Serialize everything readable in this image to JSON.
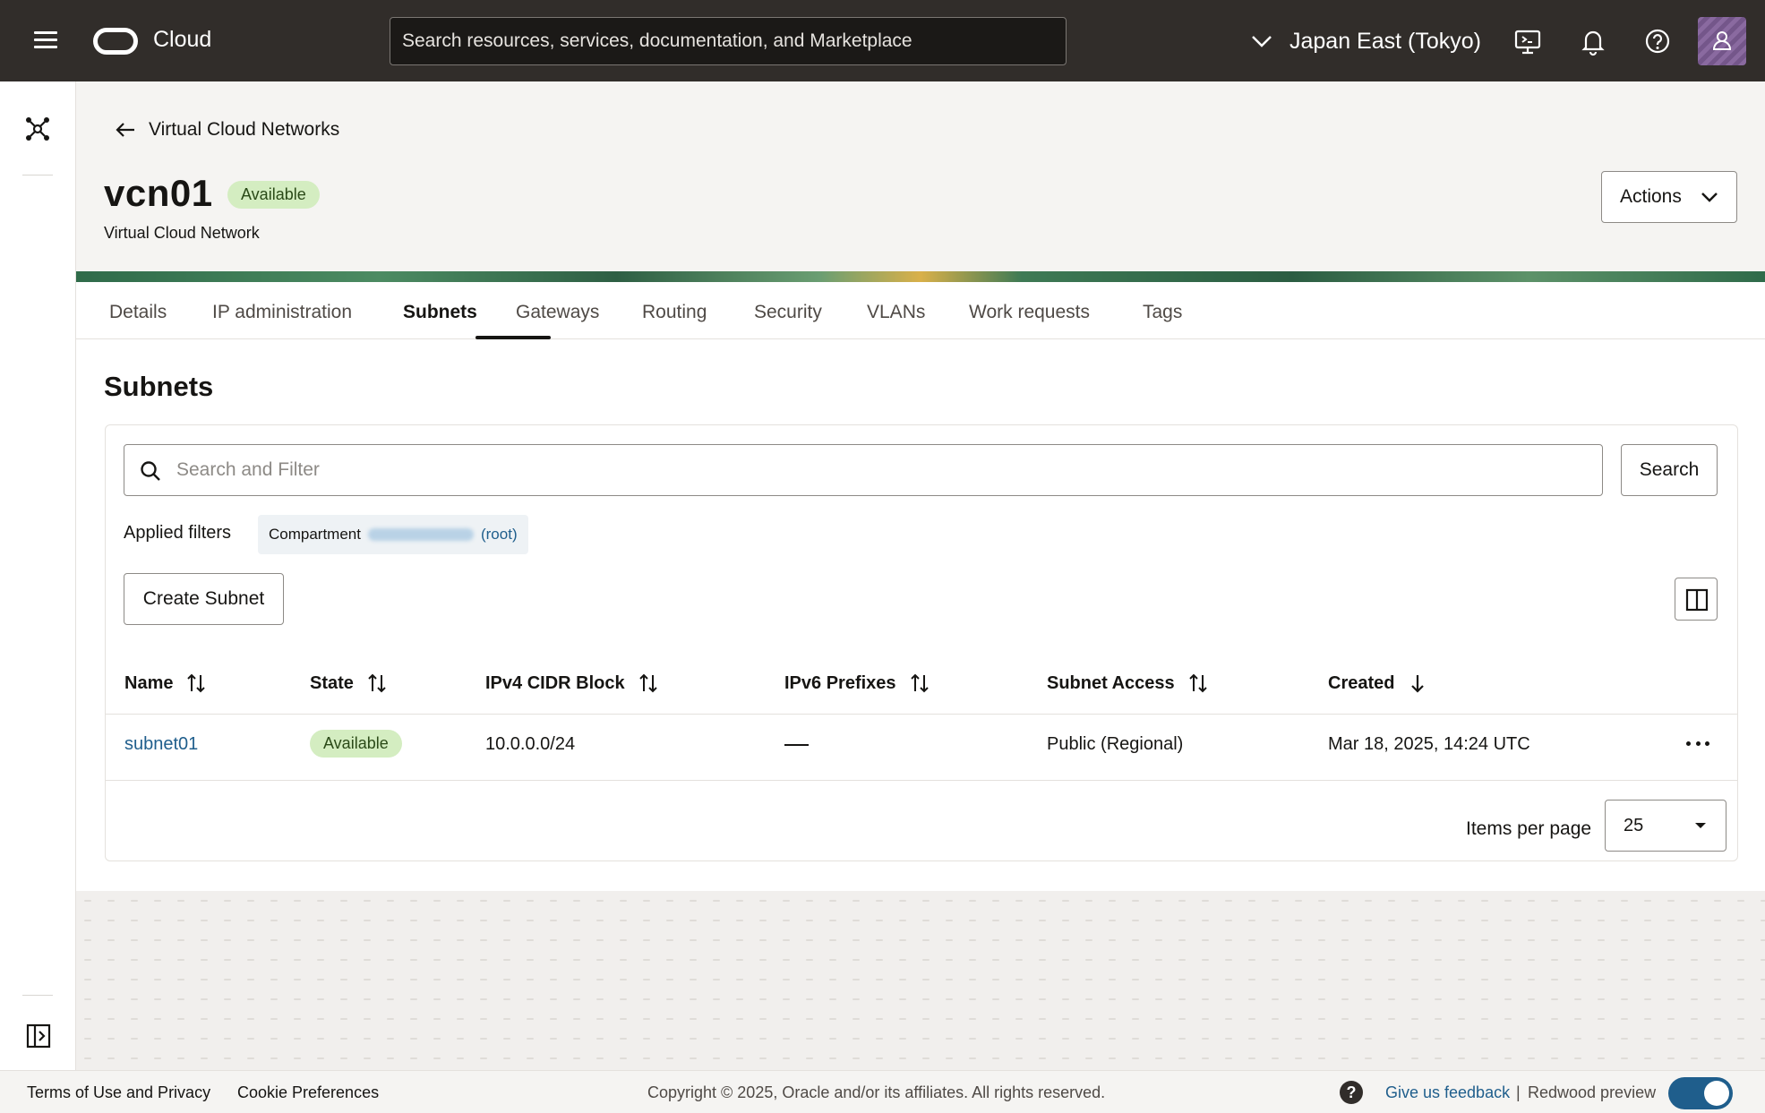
{
  "topbar": {
    "brand": "Cloud",
    "search_placeholder": "Search resources, services, documentation, and Marketplace",
    "region": "Japan East (Tokyo)"
  },
  "header": {
    "back_label": "Virtual Cloud Networks",
    "title": "vcn01",
    "status": "Available",
    "subtitle": "Virtual Cloud Network",
    "actions_label": "Actions"
  },
  "tabs": [
    {
      "label": "Details",
      "active": false
    },
    {
      "label": "IP administration",
      "active": false
    },
    {
      "label": "Subnets",
      "active": true
    },
    {
      "label": "Gateways",
      "active": false
    },
    {
      "label": "Routing",
      "active": false
    },
    {
      "label": "Security",
      "active": false
    },
    {
      "label": "VLANs",
      "active": false
    },
    {
      "label": "Work requests",
      "active": false
    },
    {
      "label": "Tags",
      "active": false
    }
  ],
  "subnets": {
    "title": "Subnets",
    "filter_placeholder": "Search and Filter",
    "search_button": "Search",
    "applied_filters_label": "Applied filters",
    "filter_chip": {
      "label": "Compartment",
      "suffix": "(root)"
    },
    "create_button": "Create Subnet",
    "columns": [
      "Name",
      "State",
      "IPv4 CIDR Block",
      "IPv6 Prefixes",
      "Subnet Access",
      "Created"
    ],
    "rows": [
      {
        "name": "subnet01",
        "state": "Available",
        "ipv4": "10.0.0.0/24",
        "ipv6": "",
        "access": "Public (Regional)",
        "created": "Mar 18, 2025, 14:24 UTC"
      }
    ],
    "items_per_page_label": "Items per page",
    "items_per_page": "25"
  },
  "footer": {
    "terms": "Terms of Use and Privacy",
    "cookies": "Cookie Preferences",
    "copyright": "Copyright © 2025, Oracle and/or its affiliates. All rights reserved.",
    "help_glyph": "?",
    "feedback": "Give us feedback",
    "separator": "|",
    "redwood": "Redwood preview",
    "redwood_enabled": true
  },
  "colors": {
    "topbar": "#312d2a",
    "link": "#1f5e8c",
    "badge_bg": "#d4edc1",
    "toggle_on": "#1f5e8c"
  }
}
